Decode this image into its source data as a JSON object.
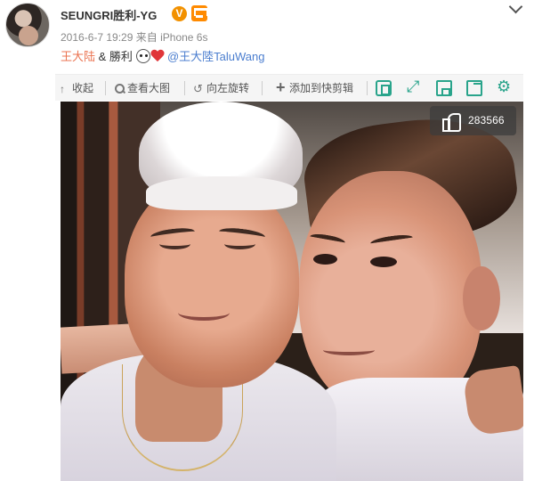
{
  "post": {
    "username": "SEUNGRI胜利-YG",
    "verified_badge": "V",
    "date": "2016-6-7 19:29",
    "source_prefix": "来自",
    "source": "iPhone 6s",
    "content": {
      "link_name": "王大陆",
      "separator": " & ",
      "name": "勝利",
      "mention": "@王大陸TaluWang"
    }
  },
  "toolbar": {
    "collapse": "收起",
    "view_large": "查看大图",
    "rotate_left": "向左旋转",
    "add_to_clip": "添加到快剪辑"
  },
  "photo": {
    "likes": "283566"
  },
  "colors": {
    "link": "#eb7350",
    "mention": "#4b7ecf",
    "verified_badge": "#f29100",
    "action_icons": "#29a48b"
  },
  "icons": {
    "collapse": "up-arrow-icon",
    "view_large": "search-icon",
    "rotate_left": "rotate-left-icon",
    "add_to_clip": "plus-icon",
    "actions": [
      "frame-icon",
      "expand-icon",
      "save-icon",
      "share-icon",
      "settings-icon"
    ],
    "likes": "thumbs-up-icon"
  }
}
